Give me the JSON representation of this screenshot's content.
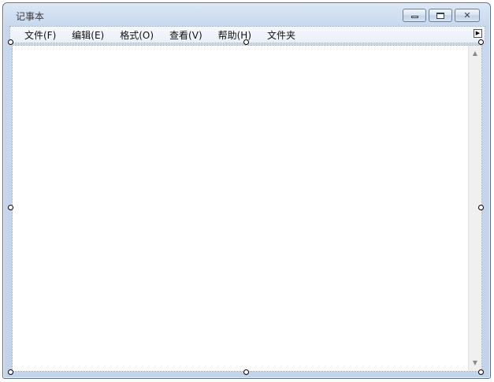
{
  "window": {
    "title": "记事本"
  },
  "menubar": {
    "items": [
      {
        "label": "文件(F)"
      },
      {
        "label": "编辑(E)"
      },
      {
        "label": "格式(O)"
      },
      {
        "label": "查看(V)"
      },
      {
        "label": "帮助(H)"
      },
      {
        "label": "文件夹"
      }
    ]
  },
  "editor": {
    "text": ""
  },
  "icons": {
    "minimize": "minimize-icon",
    "maximize": "maximize-icon",
    "close": "close-icon",
    "menu_scroll": "chevron-right-icon",
    "scroll_up": "chevron-up-icon",
    "scroll_down": "chevron-down-icon"
  }
}
